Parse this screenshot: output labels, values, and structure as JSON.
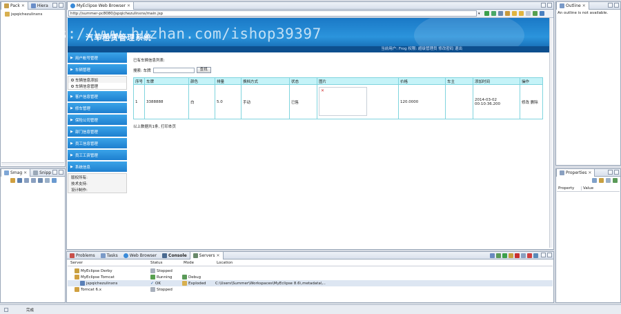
{
  "left_top": {
    "tabs": [
      {
        "label": "Pack"
      },
      {
        "label": "Hiera"
      }
    ],
    "tree_item": "jspqichezulinxns"
  },
  "left_bottom": {
    "tabs": [
      {
        "label": "Smag"
      },
      {
        "label": "Snipp"
      }
    ]
  },
  "browser": {
    "tab_label": "MyEclipse Web Browser",
    "url": "http://summer-pc8080/jspqichezulinxns/main.jsp"
  },
  "webpage": {
    "title": "汽车租赁管理系统",
    "status_strip": "当前用户: Frog  权限: 超级管理员  修改密码  退出",
    "menu": [
      {
        "label": "用户帐号管理"
      },
      {
        "label": "车辆管理"
      },
      {
        "label": "客户信息管理"
      },
      {
        "label": "修车管理"
      },
      {
        "label": "保险公司管理"
      },
      {
        "label": "部门信息管理"
      },
      {
        "label": "员工信息管理"
      },
      {
        "label": "员工工资管理"
      },
      {
        "label": "系统信息"
      }
    ],
    "submenu": [
      {
        "label": "车辆信息添加"
      },
      {
        "label": "车辆信息管理"
      }
    ],
    "info": [
      {
        "label": "版权所有:"
      },
      {
        "label": "技术支持:"
      },
      {
        "label": "设计制作:"
      }
    ],
    "breadcrumb": "已有车辆信息列表:",
    "search_label": "搜索: 车牌",
    "search_button": "查找",
    "table_headers": [
      "序号",
      "车牌",
      "颜色",
      "排量",
      "换档方式",
      "状态",
      "图片",
      "价格",
      "车主",
      "添加时间",
      "操作"
    ],
    "rows": [
      {
        "no": "1",
        "plate": "3388888",
        "color": "白",
        "displacement": "5.0",
        "gear": "手动",
        "status": "已售",
        "price": "120.0000",
        "owner": "",
        "added": "2014-03-02 00:10:36.200",
        "ops": "修改  删除"
      }
    ],
    "footer": "以上数据共1条,  打印本页"
  },
  "outline": {
    "tab": "Outline",
    "text": "An outline is not available."
  },
  "properties": {
    "tab": "Properties",
    "col_property": "Property",
    "col_value": "Value"
  },
  "console": {
    "tabs": [
      {
        "label": "Problems"
      },
      {
        "label": "Tasks"
      },
      {
        "label": "Web Browser"
      },
      {
        "label": "Console"
      },
      {
        "label": "Servers"
      }
    ],
    "headers": {
      "server": "Server",
      "status": "Status",
      "mode": "Mode",
      "location": "Location"
    },
    "servers": [
      {
        "name": "MyEclipse Derby",
        "status": "Stopped",
        "mode": "",
        "location": ""
      },
      {
        "name": "MyEclipse Tomcat",
        "status": "Running",
        "mode": "Debug",
        "location": ""
      },
      {
        "name": "jspqichezulinxns",
        "status": "OK",
        "mode": "Exploded",
        "location": "C:\\Users\\Summer\\Workspaces\\MyEclipse 8.6\\.metadata\\..."
      },
      {
        "name": "Tomcat 6.x",
        "status": "Stopped",
        "mode": "",
        "location": ""
      }
    ]
  },
  "statusbar": {
    "text": "完成"
  },
  "watermark": "https://www.huzhan.com/ishop39397",
  "colors": {
    "menu_blue": "#1e7fcf",
    "banner_blue": "#2b94dc",
    "table_header": "#c5f3f8",
    "table_border": "#7fd4de"
  }
}
